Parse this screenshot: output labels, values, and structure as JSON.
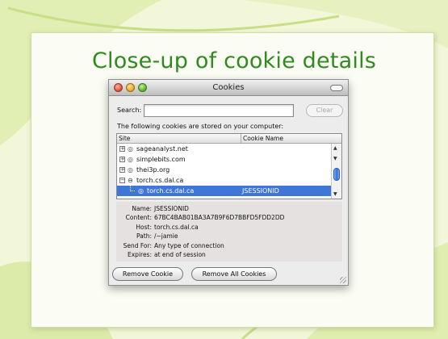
{
  "slide": {
    "title": "Close-up of cookie details"
  },
  "window": {
    "title": "Cookies",
    "search_label": "Search:",
    "search_value": "",
    "clear_label": "Clear",
    "info_text": "The following cookies are stored on your computer:",
    "columns": {
      "site": "Site",
      "cookie_name": "Cookie Name"
    },
    "rows": [
      {
        "toggle": "+",
        "icon": "globe-icon",
        "site": "sageanalyst.net",
        "cookie_name": ""
      },
      {
        "toggle": "+",
        "icon": "globe-icon",
        "site": "simplebits.com",
        "cookie_name": ""
      },
      {
        "toggle": "+",
        "icon": "globe-icon",
        "site": "thei3p.org",
        "cookie_name": ""
      },
      {
        "toggle": "−",
        "icon": "folder-open-icon",
        "site": "torch.cs.dal.ca",
        "cookie_name": ""
      },
      {
        "toggle": "",
        "icon": "globe-icon",
        "site": "torch.cs.dal.ca",
        "cookie_name": "JSESSIONID",
        "selected": true
      }
    ],
    "details": {
      "name_label": "Name:",
      "name_value": "JSESSIONID",
      "content_label": "Content:",
      "content_value": "67BC4BAB01BA3A7B9F6D7BBFD5FDD2DD",
      "host_label": "Host:",
      "host_value": "torch.cs.dal.ca",
      "path_label": "Path:",
      "path_value": "/~jamie",
      "sendfor_label": "Send For:",
      "sendfor_value": "Any type of connection",
      "expires_label": "Expires:",
      "expires_value": "at end of session"
    },
    "buttons": {
      "remove_cookie": "Remove Cookie",
      "remove_all": "Remove All Cookies"
    }
  },
  "colors": {
    "title_green": "#2f8a1f",
    "selection_blue": "#3f77d8",
    "details_bg": "#e6e1e1"
  }
}
